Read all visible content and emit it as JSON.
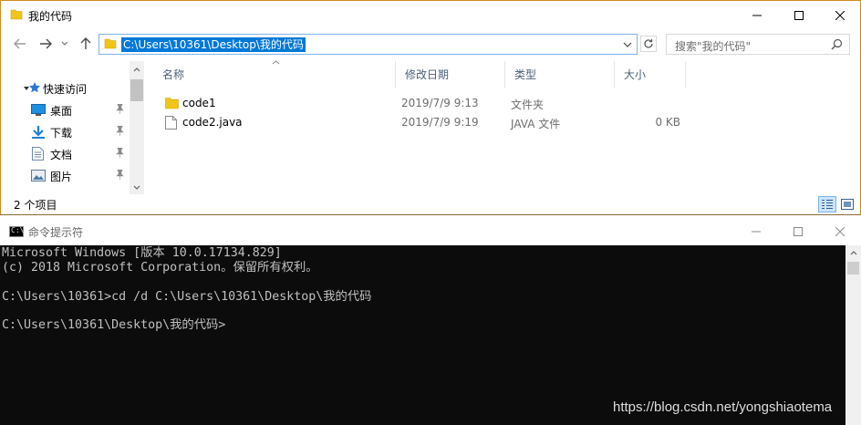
{
  "explorer": {
    "title": "我的代码",
    "address": "C:\\Users\\10361\\Desktop\\我的代码",
    "search_placeholder": "搜索\"我的代码\"",
    "nav": [
      {
        "label": "快速访问",
        "icon": "star-icon"
      },
      {
        "label": "桌面",
        "icon": "desktop-icon",
        "pinned": true
      },
      {
        "label": "下载",
        "icon": "download-icon",
        "pinned": true
      },
      {
        "label": "文档",
        "icon": "document-icon",
        "pinned": true
      },
      {
        "label": "图片",
        "icon": "picture-icon",
        "pinned": true
      }
    ],
    "columns": [
      "名称",
      "修改日期",
      "类型",
      "大小"
    ],
    "files": [
      {
        "name": "code1",
        "date": "2019/7/9 9:13",
        "type": "文件夹",
        "size": "",
        "icon": "folder-icon"
      },
      {
        "name": "code2.java",
        "date": "2019/7/9 9:19",
        "type": "JAVA 文件",
        "size": "0 KB",
        "icon": "file-icon"
      }
    ],
    "status": "2 个项目"
  },
  "cmd": {
    "title": "命令提示符",
    "icon_label": "C:\\",
    "lines": [
      "Microsoft Windows [版本 10.0.17134.829]",
      "(c) 2018 Microsoft Corporation。保留所有权利。",
      "",
      "C:\\Users\\10361>cd /d C:\\Users\\10361\\Desktop\\我的代码",
      "",
      "C:\\Users\\10361\\Desktop\\我的代码>"
    ]
  },
  "watermark": "https://blog.csdn.net/yongshiaotema",
  "colors": {
    "selection": "#0078d7",
    "folder": "#f0c419",
    "console_bg": "#0c0c0c",
    "console_fg": "#c0c0c0"
  }
}
